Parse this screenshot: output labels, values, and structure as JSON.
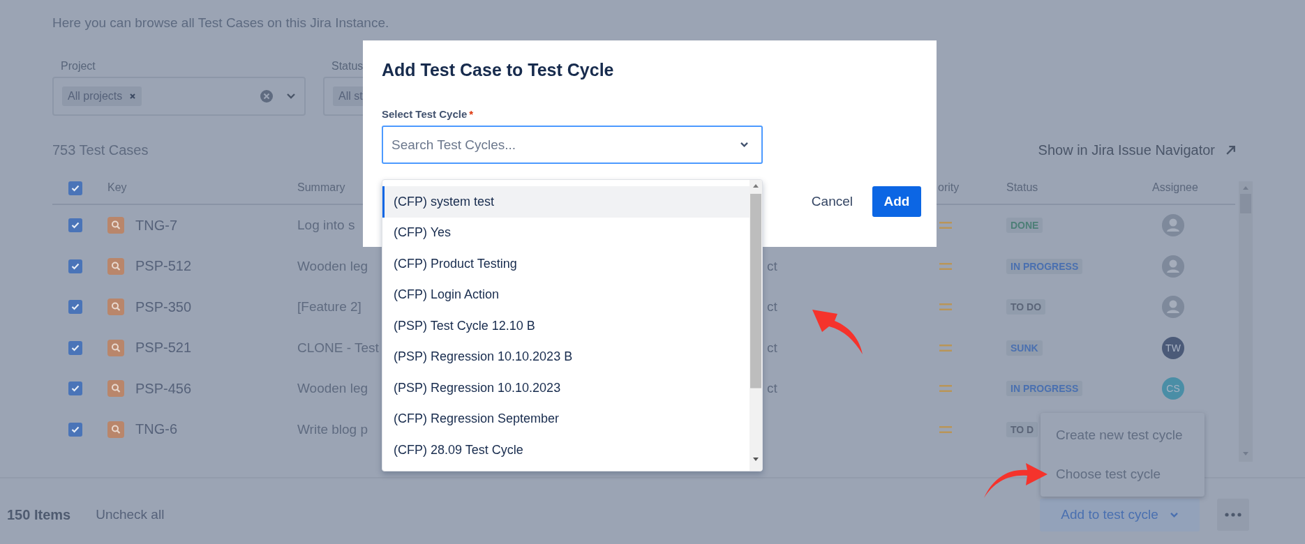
{
  "intro": "Here you can browse all Test Cases on this Jira Instance.",
  "filters": [
    {
      "label": "Project",
      "chips": [
        "All projects"
      ],
      "clearable": true
    },
    {
      "label": "Status",
      "chips": [
        "All st"
      ]
    }
  ],
  "count": "753 Test Cases",
  "navigator_link": "Show in Jira Issue Navigator",
  "table": {
    "all_checked": true,
    "columns": [
      {
        "label": "Key",
        "kind": "key"
      },
      {
        "label": "Summary",
        "kind": "summary"
      },
      {
        "label": "ority",
        "kind": "priority"
      },
      {
        "label": "Status",
        "kind": "status"
      },
      {
        "label": "Assignee",
        "kind": "assignee"
      }
    ],
    "rows": [
      {
        "checked": true,
        "key": "TNG-7",
        "summary": "Log into s",
        "status": {
          "text": "DONE",
          "color": "#4d7f77"
        },
        "assignee": {
          "kind": "default"
        }
      },
      {
        "checked": true,
        "key": "PSP-512",
        "summary": "Wooden leg",
        "column_3": "ct",
        "status": {
          "text": "IN PROGRESS",
          "color": "#4a70b0"
        },
        "assignee": {
          "kind": "default"
        }
      },
      {
        "checked": true,
        "key": "PSP-350",
        "summary": "[Feature 2]",
        "column_3": "ct",
        "status": {
          "text": "TO DO",
          "color": "#5b6578"
        },
        "assignee": {
          "kind": "default"
        }
      },
      {
        "checked": true,
        "key": "PSP-521",
        "summary": "CLONE - Test",
        "column_3": "ct",
        "status": {
          "text": "SUNK",
          "color": "#4a70b0"
        },
        "assignee": {
          "kind": "initials",
          "initials": "TW",
          "color": "#4b5a78"
        }
      },
      {
        "checked": true,
        "key": "PSP-456",
        "summary": "Wooden leg",
        "column_3": "ct",
        "status": {
          "text": "IN PROGRESS",
          "color": "#4a70b0"
        },
        "assignee": {
          "kind": "initials",
          "initials": "CS",
          "color": "#4a8ea6"
        }
      },
      {
        "checked": true,
        "key": "TNG-6",
        "summary": "Write blog p",
        "status": {
          "text": "TO D",
          "color": "#5b6578"
        }
      }
    ]
  },
  "footer": {
    "items": "150 Items",
    "uncheck": "Uncheck all",
    "add_button": "Add to test cycle",
    "menu": [
      "Create new test cycle",
      "Choose test cycle"
    ]
  },
  "modal": {
    "title": "Add Test Case to Test Cycle",
    "field_label": "Select Test Cycle",
    "required_mark": "*",
    "placeholder": "Search Test Cycles...",
    "options": [
      {
        "label": "(CFP) system test",
        "selected": true
      },
      {
        "label": "(CFP) Yes",
        "selected": false
      },
      {
        "label": "(CFP) Product Testing",
        "selected": false
      },
      {
        "label": "(CFP) Login Action",
        "selected": false
      },
      {
        "label": "(PSP) Test Cycle 12.10 B",
        "selected": false
      },
      {
        "label": "(PSP) Regression 10.10.2023 B",
        "selected": false
      },
      {
        "label": "(PSP) Regression 10.10.2023",
        "selected": false
      },
      {
        "label": "(CFP) Regression September",
        "selected": false
      },
      {
        "label": "(CFP) 28.09 Test Cycle",
        "selected": false
      }
    ],
    "cancel": "Cancel",
    "add": "Add"
  }
}
